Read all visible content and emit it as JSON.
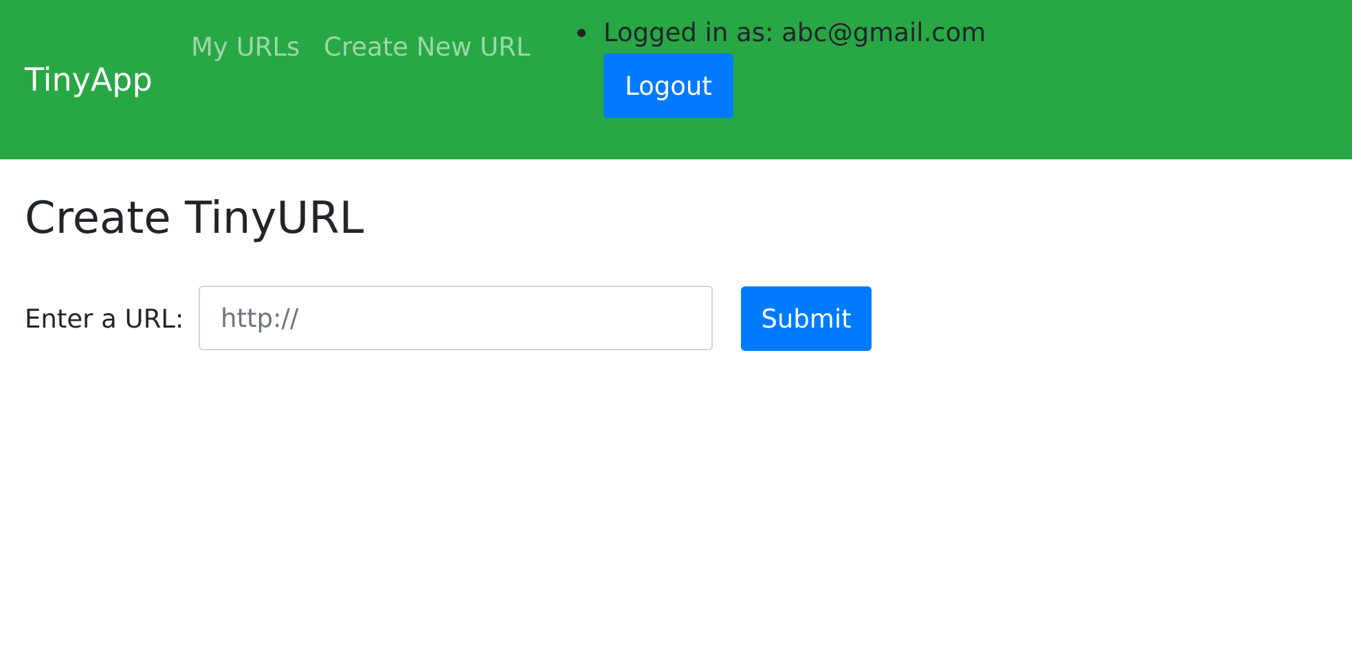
{
  "app": {
    "brand": "TinyApp"
  },
  "nav": {
    "my_urls": "My URLs",
    "create_new_url": "Create New URL"
  },
  "user": {
    "logged_in_text": "Logged in as: abc@gmail.com",
    "logout_label": "Logout"
  },
  "main": {
    "title": "Create TinyURL",
    "form": {
      "url_label": "Enter a URL:",
      "url_placeholder": "http://",
      "url_value": "",
      "submit_label": "Submit"
    }
  },
  "colors": {
    "navbar_bg": "#28a745",
    "primary_button": "#007bff",
    "nav_link": "rgba(255,255,255,0.55)",
    "text": "#212529"
  }
}
